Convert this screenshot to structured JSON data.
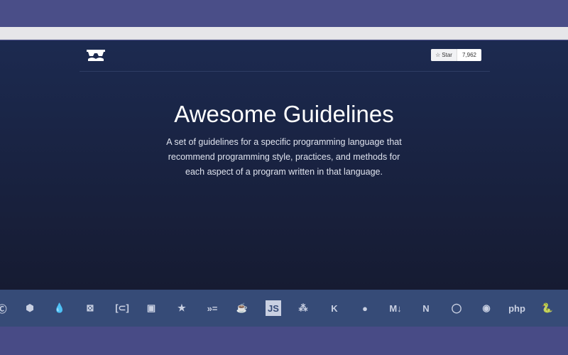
{
  "header": {
    "star_label": "Star",
    "star_count": "7,962"
  },
  "hero": {
    "title": "Awesome Guidelines",
    "description": "A set of guidelines for a specific programming language that recommend programming style, practices, and methods for each aspect of a program written in that language."
  },
  "languages": [
    {
      "icon": "c-icon",
      "glyph": "Ⓒ"
    },
    {
      "icon": "sass-icon",
      "glyph": "⬢"
    },
    {
      "icon": "elixir-icon",
      "glyph": "💧"
    },
    {
      "icon": "elm-icon",
      "glyph": "⊠"
    },
    {
      "icon": "clojure-icon",
      "glyph": "[⊂]"
    },
    {
      "icon": "go-icon",
      "glyph": "▣"
    },
    {
      "icon": "erlang-icon",
      "glyph": "★"
    },
    {
      "icon": "haskell-icon",
      "glyph": "»="
    },
    {
      "icon": "java-icon",
      "glyph": "☕"
    },
    {
      "icon": "javascript-icon",
      "glyph": "JS"
    },
    {
      "icon": "asana-icon",
      "glyph": "⁂"
    },
    {
      "icon": "kotlin-icon",
      "glyph": "K"
    },
    {
      "icon": "julia-icon",
      "glyph": "●"
    },
    {
      "icon": "markdown-icon",
      "glyph": "M↓"
    },
    {
      "icon": "dotnet-icon",
      "glyph": "N"
    },
    {
      "icon": "objective-c-icon",
      "glyph": "◯"
    },
    {
      "icon": "tor-icon",
      "glyph": "◉"
    },
    {
      "icon": "php-icon",
      "glyph": "php"
    },
    {
      "icon": "python-icon",
      "glyph": "🐍"
    }
  ]
}
